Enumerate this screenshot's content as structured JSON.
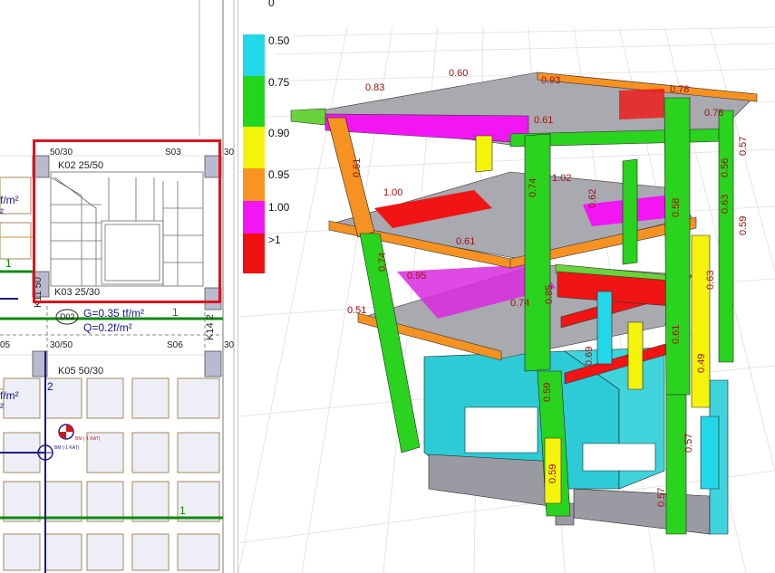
{
  "plan": {
    "labels_top": [
      "50/30",
      "S03",
      "30"
    ],
    "beam_k02": "K02 25/50",
    "beam_k03": "K03 25/30",
    "column_k11": "K11 50",
    "column_k14": "K14 2",
    "slab_d02": "D02",
    "load_g": "G=0.3",
    "load_g_suffix": "5 tf/m²",
    "load_q": "Q=0.2",
    "load_q_suffix": "f/m²",
    "slab_left_top": "f/m²",
    "slab_left_top2": "²",
    "slab_left_bot": "f/m²",
    "slab_left_bot2": "²",
    "label_05": "05",
    "label_3050": "30/50",
    "label_s06": "S06",
    "label_30": "30",
    "beam_k05": "K05 50/30",
    "axis_1_top": "1",
    "axis_1_right": "1",
    "axis_2": "2",
    "axis_1_bottom": "1",
    "label_30_right": "30",
    "small_red": "BM (-1 KAT)",
    "small_blue": "BM (-1 KAT)"
  },
  "legend": {
    "items": [
      {
        "label": "0",
        "color": "#ffffff"
      },
      {
        "label": "0.50",
        "color": "#22d8e8"
      },
      {
        "label": "0.75",
        "color": "#22d61c"
      },
      {
        "label": "0.90",
        "color": "#f4f40a"
      },
      {
        "label": "0.95",
        "color": "#f89422"
      },
      {
        "label": "1.00",
        "color": "#f216f2"
      },
      {
        "label": ">1",
        "color": "#f01010"
      }
    ]
  },
  "member_ratios": [
    "0.83",
    "0.60",
    "0.93",
    "0.78",
    "0.78",
    "0.61",
    "1.02",
    "1.00",
    "0.61",
    "0.74",
    "0.58",
    "0.56",
    "0.57",
    "0.95",
    "0.51",
    "0.74",
    "0.62",
    "0.61",
    "0.63",
    "0.57",
    "0.69",
    "0.59",
    "0.59",
    "0.74",
    "0.61",
    "0.63",
    "0.59",
    "0.49",
    "0.57",
    "0.85"
  ]
}
